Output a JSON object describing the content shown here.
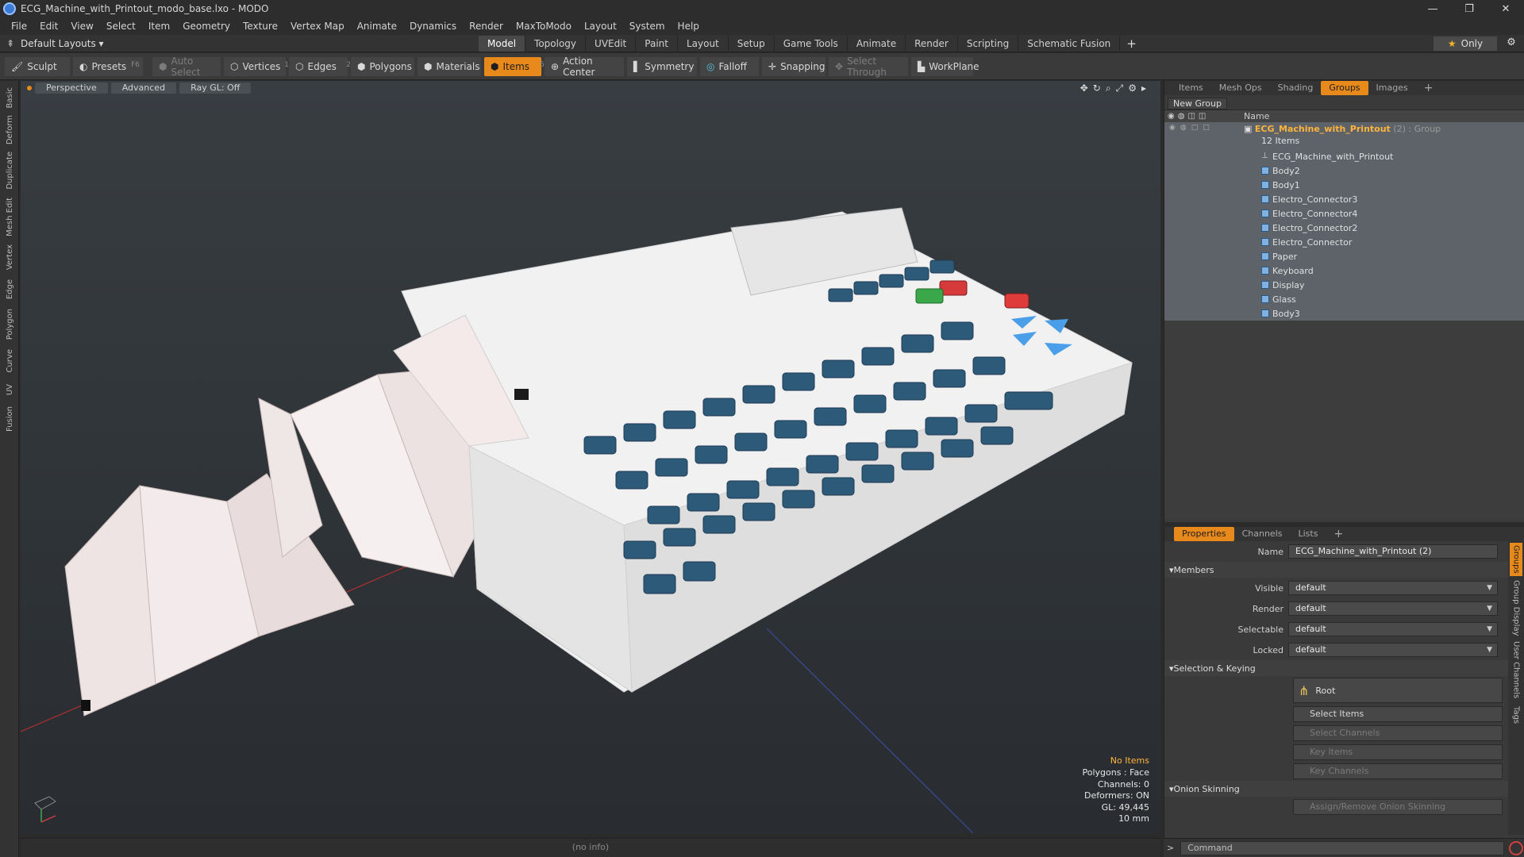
{
  "window": {
    "title": "ECG_Machine_with_Printout_modo_base.lxo - MODO",
    "minimize": "—",
    "restore": "❐",
    "close": "✕"
  },
  "menu": [
    "File",
    "Edit",
    "View",
    "Select",
    "Item",
    "Geometry",
    "Texture",
    "Vertex Map",
    "Animate",
    "Dynamics",
    "Render",
    "MaxToModo",
    "Layout",
    "System",
    "Help"
  ],
  "modebar": {
    "layouts_label": "Default Layouts ▾",
    "tabs": [
      "Model",
      "Topology",
      "UVEdit",
      "Paint",
      "Layout",
      "Setup",
      "Game Tools",
      "Animate",
      "Render",
      "Scripting",
      "Schematic Fusion"
    ],
    "plus": "+",
    "only_label": "Only",
    "star": "★",
    "gear": "⚙"
  },
  "toolbar": {
    "sculpt": "Sculpt",
    "presets": "Presets",
    "presets_key": "F6",
    "auto_select": "Auto Select",
    "vertices": "Vertices",
    "vertices_num": "1",
    "edges": "Edges",
    "edges_num": "2",
    "polygons": "Polygons",
    "materials": "Materials",
    "items": "Items",
    "items_num": "5",
    "action_center": "Action Center",
    "symmetry": "Symmetry",
    "falloff": "Falloff",
    "snapping": "Snapping",
    "select_through": "Select Through",
    "workplane": "WorkPlane"
  },
  "left_tabs": [
    "Basic",
    "Deform",
    "Duplicate",
    "Mesh Edit",
    "Vertex",
    "Edge",
    "Polygon",
    "Curve",
    "UV",
    "Fusion"
  ],
  "viewport": {
    "perspective": "Perspective",
    "advanced": "Advanced",
    "raygl": "Ray GL: Off"
  },
  "hud": {
    "no_items": "No Items",
    "polygons": "Polygons : Face",
    "channels": "Channels: 0",
    "deformers": "Deformers: ON",
    "gl": "GL: 49,445",
    "scale": "10 mm"
  },
  "status": {
    "info": "(no info)"
  },
  "right_panel": {
    "tabs": [
      "Items",
      "Mesh Ops",
      "Shading",
      "Groups",
      "Images"
    ],
    "active_tab": "Groups",
    "plus": "+",
    "new_group": "New Group",
    "name_header": "Name",
    "group": {
      "name": "ECG_Machine_with_Printout",
      "info": "(2) : Group",
      "count": "12 Items"
    },
    "items": [
      "ECG_Machine_with_Printout",
      "Body2",
      "Body1",
      "Electro_Connector3",
      "Electro_Connector4",
      "Electro_Connector2",
      "Electro_Connector",
      "Paper",
      "Keyboard",
      "Display",
      "Glass",
      "Body3"
    ]
  },
  "properties": {
    "tabs": [
      "Properties",
      "Channels",
      "Lists"
    ],
    "plus": "+",
    "name_label": "Name",
    "name_value": "ECG_Machine_with_Printout (2)",
    "members": "Members",
    "visible_label": "Visible",
    "render_label": "Render",
    "selectable_label": "Selectable",
    "locked_label": "Locked",
    "default": "default",
    "selection_keying": "Selection & Keying",
    "root": "Root",
    "select_items": "Select Items",
    "select_channels": "Select Channels",
    "key_items": "Key Items",
    "key_channels": "Key Channels",
    "onion": "Onion Skinning",
    "assign_onion": "Assign/Remove Onion Skinning",
    "side_tabs": [
      "Groups",
      "Group Display",
      "User Channels",
      "Tags"
    ]
  },
  "command": {
    "placeholder": "Command",
    "prompt": ">"
  }
}
